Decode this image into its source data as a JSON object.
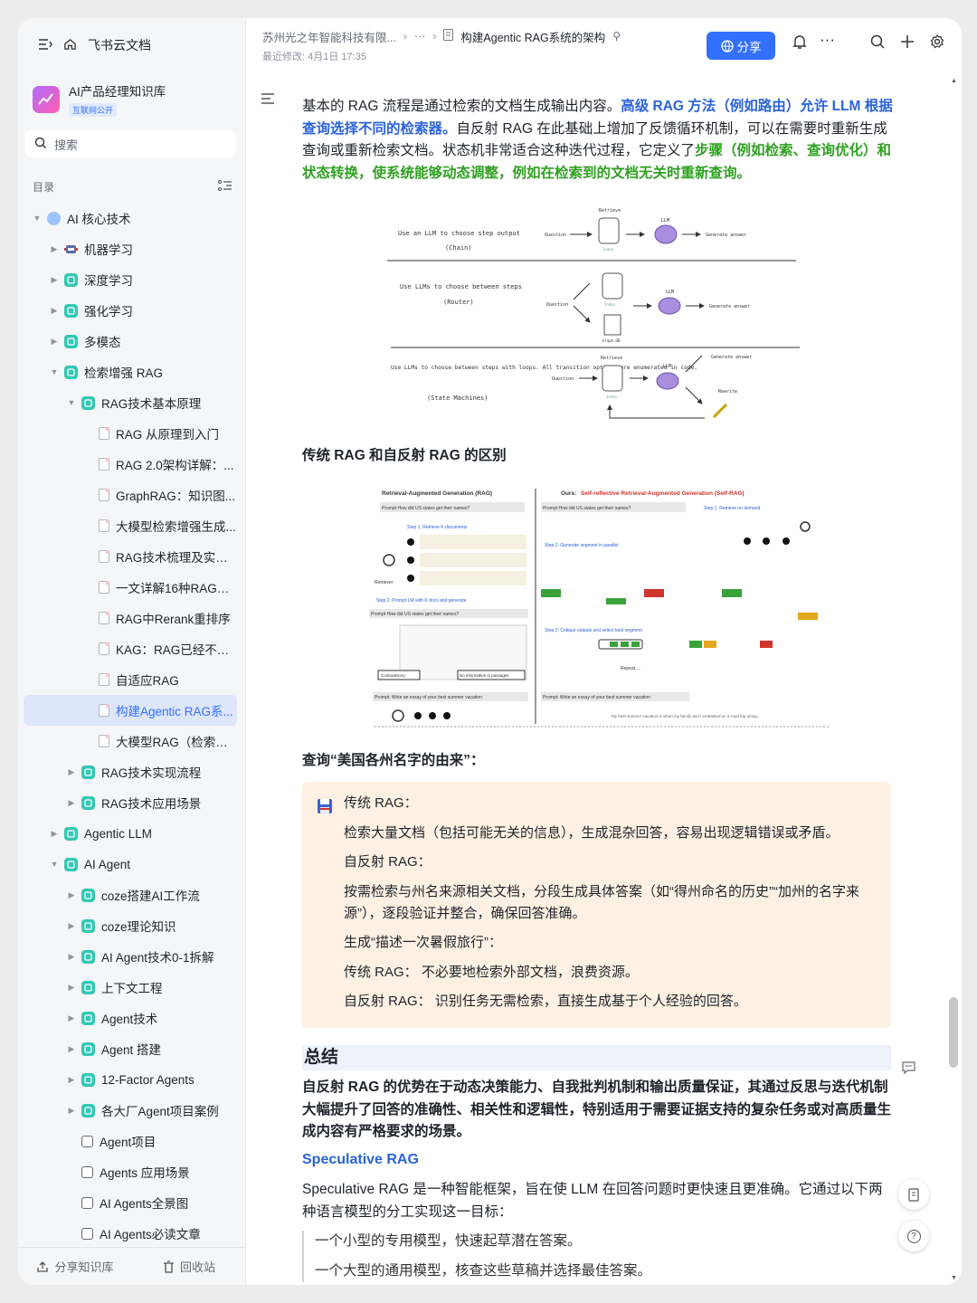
{
  "sidebar": {
    "app_title": "飞书云文档",
    "kb_title": "AI产品经理知识库",
    "kb_badge": "互联网公开",
    "search_placeholder": "搜索",
    "toc_label": "目录",
    "items": [
      {
        "label": "AI 核心技术",
        "level": 0,
        "icon": "globe",
        "arrow": "down"
      },
      {
        "label": "机器学习",
        "level": 1,
        "icon": "robot",
        "arrow": "right"
      },
      {
        "label": "深度学习",
        "level": 1,
        "icon": "kb",
        "arrow": "right"
      },
      {
        "label": "强化学习",
        "level": 1,
        "icon": "kb",
        "arrow": "right"
      },
      {
        "label": "多模态",
        "level": 1,
        "icon": "kb",
        "arrow": "right"
      },
      {
        "label": "检索增强 RAG",
        "level": 1,
        "icon": "kb",
        "arrow": "down"
      },
      {
        "label": "RAG技术基本原理",
        "level": 2,
        "icon": "kb",
        "arrow": "down"
      },
      {
        "label": "RAG 从原理到入门",
        "level": 3,
        "icon": "doc",
        "arrow": ""
      },
      {
        "label": "RAG 2.0架构详解：...",
        "level": 3,
        "icon": "doc",
        "arrow": ""
      },
      {
        "label": "GraphRAG：知识图...",
        "level": 3,
        "icon": "doc",
        "arrow": ""
      },
      {
        "label": "大模型检索增强生成...",
        "level": 3,
        "icon": "doc",
        "arrow": ""
      },
      {
        "label": "RAG技术梳理及实践...",
        "level": 3,
        "icon": "doc",
        "arrow": ""
      },
      {
        "label": "一文详解16种RAG架...",
        "level": 3,
        "icon": "doc",
        "arrow": ""
      },
      {
        "label": "RAG中Rerank重排序",
        "level": 3,
        "icon": "doc",
        "arrow": ""
      },
      {
        "label": "KAG：RAG已经不够...",
        "level": 3,
        "icon": "doc",
        "arrow": ""
      },
      {
        "label": "自适应RAG",
        "level": 3,
        "icon": "doc",
        "arrow": ""
      },
      {
        "label": "构建Agentic RAG系...",
        "level": 3,
        "icon": "doc",
        "arrow": "",
        "selected": true
      },
      {
        "label": "大模型RAG（检索增...",
        "level": 3,
        "icon": "doc",
        "arrow": ""
      },
      {
        "label": "RAG技术实现流程",
        "level": 2,
        "icon": "kb",
        "arrow": "right"
      },
      {
        "label": "RAG技术应用场景",
        "level": 2,
        "icon": "kb",
        "arrow": "right"
      },
      {
        "label": "Agentic LLM",
        "level": 1,
        "icon": "kb",
        "arrow": "right"
      },
      {
        "label": "AI Agent",
        "level": 1,
        "icon": "kb",
        "arrow": "down"
      },
      {
        "label": "coze搭建AI工作流",
        "level": 2,
        "icon": "kb",
        "arrow": "right"
      },
      {
        "label": "coze理论知识",
        "level": 2,
        "icon": "kb",
        "arrow": "right"
      },
      {
        "label": "AI Agent技术0-1拆解",
        "level": 2,
        "icon": "kb",
        "arrow": "right"
      },
      {
        "label": "上下文工程",
        "level": 2,
        "icon": "kb",
        "arrow": "right"
      },
      {
        "label": "Agent技术",
        "level": 2,
        "icon": "kb",
        "arrow": "right"
      },
      {
        "label": "Agent 搭建",
        "level": 2,
        "icon": "kb",
        "arrow": "right"
      },
      {
        "label": "12-Factor Agents",
        "level": 2,
        "icon": "kb",
        "arrow": "right"
      },
      {
        "label": "各大厂Agent项目案例",
        "level": 2,
        "icon": "kb",
        "arrow": "right"
      },
      {
        "label": "Agent项目",
        "level": 2,
        "icon": "box",
        "arrow": ""
      },
      {
        "label": "Agents 应用场景",
        "level": 2,
        "icon": "box",
        "arrow": ""
      },
      {
        "label": "AI Agents全景图",
        "level": 2,
        "icon": "box",
        "arrow": ""
      },
      {
        "label": "AI Agents必读文章",
        "level": 2,
        "icon": "box",
        "arrow": ""
      }
    ],
    "share_kb": "分享知识库",
    "recycle": "回收站"
  },
  "header": {
    "crumb_org": "苏州光之年智能科技有限...",
    "crumb_more": "···",
    "crumb_doc": "构建Agentic RAG系统的架构",
    "modified": "最近修改: 4月1日 17:35",
    "share": "分享"
  },
  "content": {
    "para1_a": "基本的 RAG 流程是通过检索的文档生成输出内容。",
    "para1_b": "高级 RAG 方法（例如路由）允许 LLM 根据查询选择不同的检索器。",
    "para1_c": "自反射 RAG 在此基础上增加了反馈循环机制，可以在需要时重新生成查询或重新检索文档。状态机非常适合这种迭代过程，它定义了",
    "para1_d": "步骤（例如检索、查询优化）和状态转换，使系统能够动态调整，例如在检索到的文档无关时重新查询。",
    "fig1": {
      "row1": "Use an LLM to choose step output",
      "row1b": "(Chain)",
      "row2": "Use LLMs to choose between steps",
      "row2b": "(Router)",
      "row3": "Use LLMs to choose between steps with loops. All transition options are enumerated in code.",
      "row3b": "(State Machines)",
      "question": "Question",
      "retrieve": "Retrieve",
      "index": "Index",
      "llm": "LLM",
      "generate": "Generate answer",
      "rewrite": "Rewrite",
      "graph": "Graph DB"
    },
    "h_diff": "传统 RAG 和自反射 RAG 的区别",
    "fig2": {
      "left_title": "Retrieval-Augmented Generation (RAG)",
      "right_title_a": "Ours: ",
      "right_title_b": "Self-reflective Retrieval-Augmented Generation (Self-RAG)",
      "prompt1": "Prompt How did US states get their names?",
      "step1": "Step 1: Retrieve K documents",
      "step1r": "Step 1: Retrieve on demand",
      "step2": "Step 2: Prompt LM with K docs and generate",
      "step2r": "Step 2: Generate segment in parallel",
      "step3r": "Step 3: Critique outputs and select best segment",
      "prompt2": "Prompt: Write an essay of your best summer vacation",
      "retriever": "Retriever",
      "contradictory": "Contradictory",
      "no_info": "No information in passages",
      "repeat": "Repeat....",
      "my_best": "My best summer vacation is when my family and I embarked on a road trip along..."
    },
    "h_query": "查询“美国各州名字的由来”：",
    "callout": [
      "传统 RAG：",
      "检索大量文档（包括可能无关的信息），生成混杂回答，容易出现逻辑错误或矛盾。",
      "自反射 RAG：",
      "按需检索与州名来源相关文档，分段生成具体答案（如“得州命名的历史”“加州的名字来",
      "源”），逐段验证并整合，确保回答准确。",
      "生成“描述一次暑假旅行”：",
      "传统 RAG： 不必要地检索外部文档，浪费资源。",
      "自反射 RAG： 识别任务无需检索，直接生成基于个人经验的回答。"
    ],
    "summary_h": "总结",
    "summary": "自反射 RAG 的优势在于动态决策能力、自我批判机制和输出质量保证，其通过反思与迭代机制大幅提升了回答的准确性、相关性和逻辑性，特别适用于需要证据支持的复杂任务或对高质量生成内容有严格要求的场景。",
    "spec_h": "Speculative RAG",
    "spec_p": "Speculative RAG 是一种智能框架，旨在使 LLM 在回答问题时更快速且更准确。它通过以下两种语言模型的分工实现这一目标：",
    "quote1": "一个小型的专用模型，快速起草潜在答案。",
    "quote2": "一个大型的通用模型，核查这些草稿并选择最佳答案。"
  },
  "colors": {
    "accent": "#3370ff",
    "green": "#2ea121",
    "callout_bg": "#fef1e3"
  }
}
